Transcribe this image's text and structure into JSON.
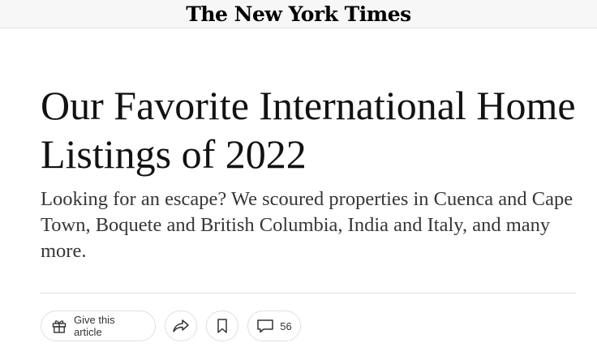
{
  "masthead": {
    "logo_text": "The New York Times"
  },
  "article": {
    "headline": "Our Favorite International Home Listings of 2022",
    "summary": "Looking for an escape? We scoured properties in Cuenca and Cape Town, Boquete and British Columbia, India and Italy, and many more."
  },
  "toolbar": {
    "gift_label": "Give this article",
    "comment_count": "56",
    "icons": [
      "gift-icon",
      "share-icon",
      "bookmark-icon",
      "comment-icon"
    ]
  }
}
